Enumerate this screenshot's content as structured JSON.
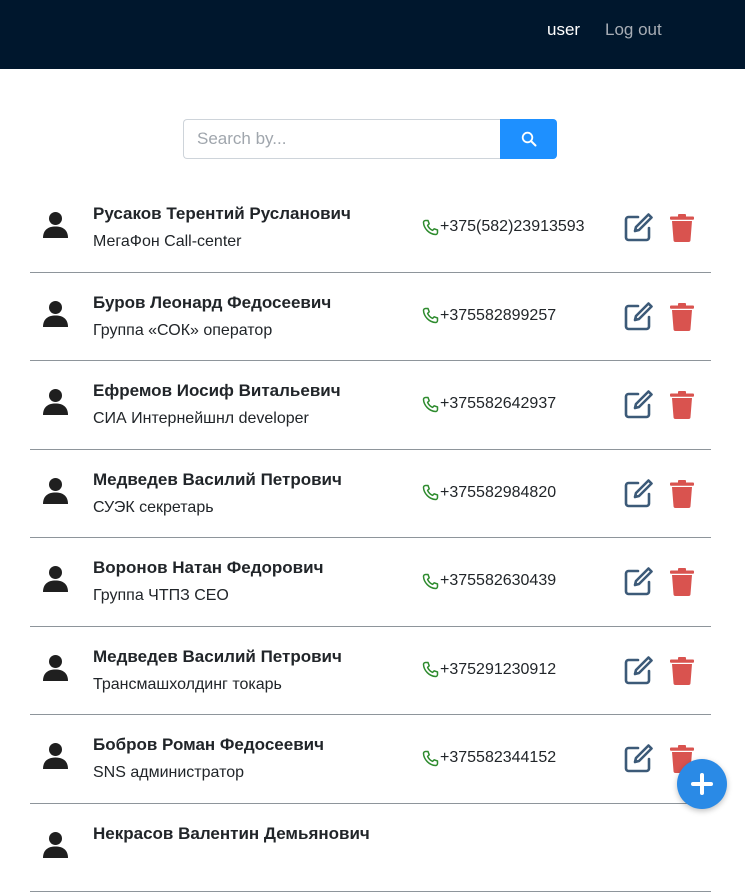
{
  "nav": {
    "user_label": "user",
    "logout_label": "Log out"
  },
  "search": {
    "placeholder": "Search by...",
    "value": ""
  },
  "colors": {
    "navbar": "#00172d",
    "search_button": "#1e90ff",
    "phone_icon": "#2e8b2e",
    "edit_icon": "#3c5a78",
    "delete_icon": "#d9534f",
    "fab": "#2a8ae6"
  },
  "icons": {
    "search": "search-icon",
    "avatar": "user-icon",
    "phone": "phone-icon",
    "edit": "edit-icon",
    "delete": "trash-icon",
    "add": "plus-icon"
  },
  "contacts": [
    {
      "name": "Русаков Терентий Русланович",
      "job": "МегаФон Call-center",
      "phone": "+375(582)23913593"
    },
    {
      "name": "Буров Леонард Федосеевич",
      "job": "Группа «СОК» оператор",
      "phone": "+375582899257"
    },
    {
      "name": "Ефремов Иосиф Витальевич",
      "job": "СИА Интернейшнл developer",
      "phone": "+375582642937"
    },
    {
      "name": "Медведев Василий Петрович",
      "job": "СУЭК секретарь",
      "phone": "+375582984820"
    },
    {
      "name": "Воронов Натан Федорович",
      "job": "Группа ЧТПЗ CEO",
      "phone": "+375582630439"
    },
    {
      "name": "Медведев Василий Петрович",
      "job": "Трансмашхолдинг токарь",
      "phone": "+375291230912"
    },
    {
      "name": "Бобров Роман Федосеевич",
      "job": "SNS администратор",
      "phone": "+375582344152"
    },
    {
      "name": "Некрасов Валентин Демьянович",
      "job": "",
      "phone": ""
    }
  ]
}
